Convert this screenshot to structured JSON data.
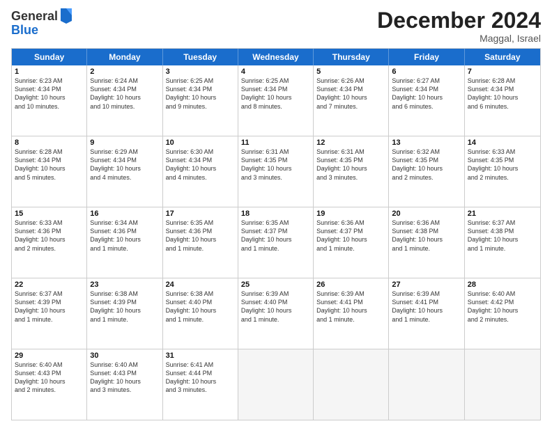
{
  "logo": {
    "general": "General",
    "blue": "Blue"
  },
  "title": "December 2024",
  "location": "Maggal, Israel",
  "days_of_week": [
    "Sunday",
    "Monday",
    "Tuesday",
    "Wednesday",
    "Thursday",
    "Friday",
    "Saturday"
  ],
  "weeks": [
    [
      {
        "day": "1",
        "text": "Sunrise: 6:23 AM\nSunset: 4:34 PM\nDaylight: 10 hours\nand 10 minutes."
      },
      {
        "day": "2",
        "text": "Sunrise: 6:24 AM\nSunset: 4:34 PM\nDaylight: 10 hours\nand 10 minutes."
      },
      {
        "day": "3",
        "text": "Sunrise: 6:25 AM\nSunset: 4:34 PM\nDaylight: 10 hours\nand 9 minutes."
      },
      {
        "day": "4",
        "text": "Sunrise: 6:25 AM\nSunset: 4:34 PM\nDaylight: 10 hours\nand 8 minutes."
      },
      {
        "day": "5",
        "text": "Sunrise: 6:26 AM\nSunset: 4:34 PM\nDaylight: 10 hours\nand 7 minutes."
      },
      {
        "day": "6",
        "text": "Sunrise: 6:27 AM\nSunset: 4:34 PM\nDaylight: 10 hours\nand 6 minutes."
      },
      {
        "day": "7",
        "text": "Sunrise: 6:28 AM\nSunset: 4:34 PM\nDaylight: 10 hours\nand 6 minutes."
      }
    ],
    [
      {
        "day": "8",
        "text": "Sunrise: 6:28 AM\nSunset: 4:34 PM\nDaylight: 10 hours\nand 5 minutes."
      },
      {
        "day": "9",
        "text": "Sunrise: 6:29 AM\nSunset: 4:34 PM\nDaylight: 10 hours\nand 4 minutes."
      },
      {
        "day": "10",
        "text": "Sunrise: 6:30 AM\nSunset: 4:34 PM\nDaylight: 10 hours\nand 4 minutes."
      },
      {
        "day": "11",
        "text": "Sunrise: 6:31 AM\nSunset: 4:35 PM\nDaylight: 10 hours\nand 3 minutes."
      },
      {
        "day": "12",
        "text": "Sunrise: 6:31 AM\nSunset: 4:35 PM\nDaylight: 10 hours\nand 3 minutes."
      },
      {
        "day": "13",
        "text": "Sunrise: 6:32 AM\nSunset: 4:35 PM\nDaylight: 10 hours\nand 2 minutes."
      },
      {
        "day": "14",
        "text": "Sunrise: 6:33 AM\nSunset: 4:35 PM\nDaylight: 10 hours\nand 2 minutes."
      }
    ],
    [
      {
        "day": "15",
        "text": "Sunrise: 6:33 AM\nSunset: 4:36 PM\nDaylight: 10 hours\nand 2 minutes."
      },
      {
        "day": "16",
        "text": "Sunrise: 6:34 AM\nSunset: 4:36 PM\nDaylight: 10 hours\nand 1 minute."
      },
      {
        "day": "17",
        "text": "Sunrise: 6:35 AM\nSunset: 4:36 PM\nDaylight: 10 hours\nand 1 minute."
      },
      {
        "day": "18",
        "text": "Sunrise: 6:35 AM\nSunset: 4:37 PM\nDaylight: 10 hours\nand 1 minute."
      },
      {
        "day": "19",
        "text": "Sunrise: 6:36 AM\nSunset: 4:37 PM\nDaylight: 10 hours\nand 1 minute."
      },
      {
        "day": "20",
        "text": "Sunrise: 6:36 AM\nSunset: 4:38 PM\nDaylight: 10 hours\nand 1 minute."
      },
      {
        "day": "21",
        "text": "Sunrise: 6:37 AM\nSunset: 4:38 PM\nDaylight: 10 hours\nand 1 minute."
      }
    ],
    [
      {
        "day": "22",
        "text": "Sunrise: 6:37 AM\nSunset: 4:39 PM\nDaylight: 10 hours\nand 1 minute."
      },
      {
        "day": "23",
        "text": "Sunrise: 6:38 AM\nSunset: 4:39 PM\nDaylight: 10 hours\nand 1 minute."
      },
      {
        "day": "24",
        "text": "Sunrise: 6:38 AM\nSunset: 4:40 PM\nDaylight: 10 hours\nand 1 minute."
      },
      {
        "day": "25",
        "text": "Sunrise: 6:39 AM\nSunset: 4:40 PM\nDaylight: 10 hours\nand 1 minute."
      },
      {
        "day": "26",
        "text": "Sunrise: 6:39 AM\nSunset: 4:41 PM\nDaylight: 10 hours\nand 1 minute."
      },
      {
        "day": "27",
        "text": "Sunrise: 6:39 AM\nSunset: 4:41 PM\nDaylight: 10 hours\nand 1 minute."
      },
      {
        "day": "28",
        "text": "Sunrise: 6:40 AM\nSunset: 4:42 PM\nDaylight: 10 hours\nand 2 minutes."
      }
    ],
    [
      {
        "day": "29",
        "text": "Sunrise: 6:40 AM\nSunset: 4:43 PM\nDaylight: 10 hours\nand 2 minutes."
      },
      {
        "day": "30",
        "text": "Sunrise: 6:40 AM\nSunset: 4:43 PM\nDaylight: 10 hours\nand 3 minutes."
      },
      {
        "day": "31",
        "text": "Sunrise: 6:41 AM\nSunset: 4:44 PM\nDaylight: 10 hours\nand 3 minutes."
      },
      {
        "day": "",
        "text": ""
      },
      {
        "day": "",
        "text": ""
      },
      {
        "day": "",
        "text": ""
      },
      {
        "day": "",
        "text": ""
      }
    ]
  ]
}
